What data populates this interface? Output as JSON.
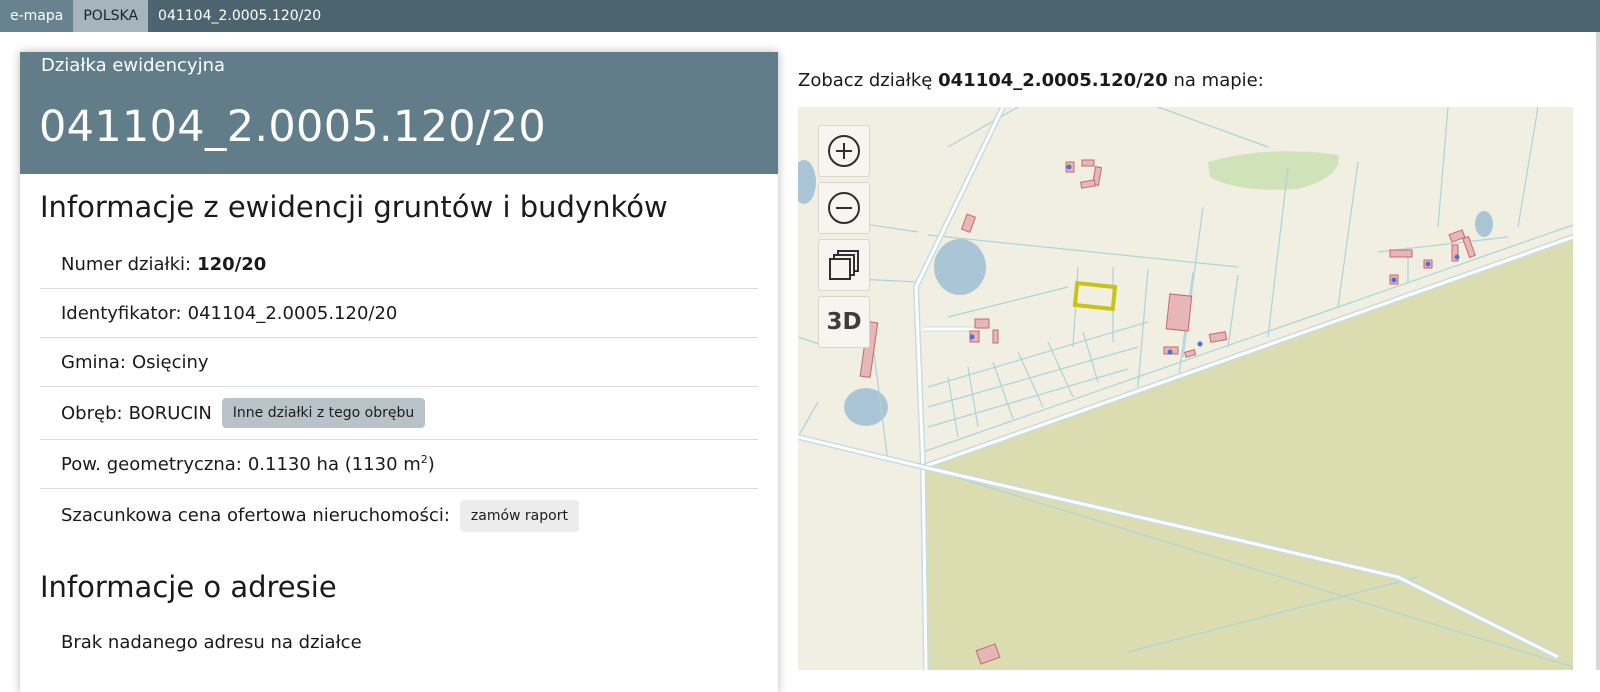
{
  "breadcrumb": [
    "e-mapa",
    "POLSKA",
    "041104_2.0005.120/20"
  ],
  "card": {
    "label": "Działka ewidencyjna",
    "title": "041104_2.0005.120/20"
  },
  "egib": {
    "heading": "Informacje z ewidencji gruntów i budynków",
    "numer_label": "Numer działki:",
    "numer_value": "120/20",
    "ident_label": "Identyfikator:",
    "ident_value": "041104_2.0005.120/20",
    "gmina_label": "Gmina:",
    "gmina_value": "Osięciny",
    "obreb_label": "Obręb:",
    "obreb_value": "BORUCIN",
    "obreb_button": "Inne działki z tego obrębu",
    "pow_label": "Pow. geometryczna:",
    "pow_value": "0.1130 ha (1130 m",
    "pow_sup": "2",
    "pow_close": ")",
    "cena_label": "Szacunkowa cena ofertowa nieruchomości:",
    "cena_button": "zamów raport"
  },
  "address": {
    "heading": "Informacje o adresie",
    "none_text": "Brak nadanego adresu na działce"
  },
  "map": {
    "caption_prefix": "Zobacz działkę",
    "caption_id": "041104_2.0005.120/20",
    "caption_suffix": "na mapie:",
    "controls": {
      "zoom_in_icon": "plus-circle-icon",
      "zoom_out_icon": "minus-circle-icon",
      "layers_icon": "layers-icon",
      "three_d_label": "3D"
    },
    "colors": {
      "land": "#f1eee2",
      "forest": "#dcdcb1",
      "water": "#aac6d6",
      "parcel_line": "#a9d4db",
      "building": "#d9a5a5",
      "highlight": "#c8c416"
    }
  }
}
